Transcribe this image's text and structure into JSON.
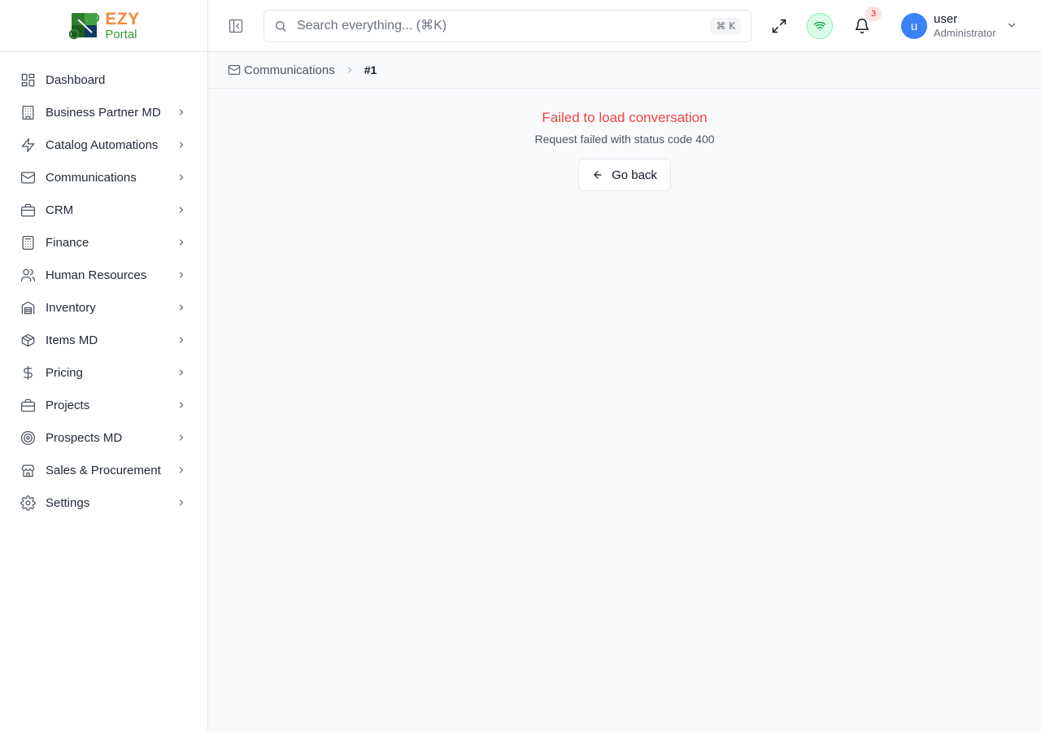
{
  "brand": {
    "line1": "EZY",
    "line2": "Portal"
  },
  "sidebar": {
    "items": [
      {
        "label": "Dashboard",
        "icon": "dashboard-icon",
        "has_children": false
      },
      {
        "label": "Business Partner MD",
        "icon": "building-icon",
        "has_children": true
      },
      {
        "label": "Catalog Automations",
        "icon": "lightning-icon",
        "has_children": true
      },
      {
        "label": "Communications",
        "icon": "mail-icon",
        "has_children": true
      },
      {
        "label": "CRM",
        "icon": "briefcase-icon",
        "has_children": true
      },
      {
        "label": "Finance",
        "icon": "calculator-icon",
        "has_children": true
      },
      {
        "label": "Human Resources",
        "icon": "users-icon",
        "has_children": true
      },
      {
        "label": "Inventory",
        "icon": "warehouse-icon",
        "has_children": true
      },
      {
        "label": "Items MD",
        "icon": "box-icon",
        "has_children": true
      },
      {
        "label": "Pricing",
        "icon": "dollar-icon",
        "has_children": true
      },
      {
        "label": "Projects",
        "icon": "briefcase-icon",
        "has_children": true
      },
      {
        "label": "Prospects MD",
        "icon": "target-icon",
        "has_children": true
      },
      {
        "label": "Sales & Procurement",
        "icon": "store-icon",
        "has_children": true
      },
      {
        "label": "Settings",
        "icon": "gear-icon",
        "has_children": true
      }
    ]
  },
  "header": {
    "search": {
      "placeholder": "Search everything... (⌘K)",
      "value": "",
      "shortcut": "⌘ K"
    },
    "notifications_count": "3",
    "connection_status_color": "#16a34a",
    "user": {
      "initial": "u",
      "name": "user",
      "role": "Administrator"
    }
  },
  "breadcrumb": {
    "parent": "Communications",
    "current": "#1"
  },
  "error": {
    "title": "Failed to load conversation",
    "detail": "Request failed with status code 400",
    "button_label": "Go back"
  },
  "colors": {
    "error": "#ef4444",
    "avatar": "#3b82f6",
    "brand_orange": "#f08a3c",
    "brand_green": "#3a9a3a"
  }
}
